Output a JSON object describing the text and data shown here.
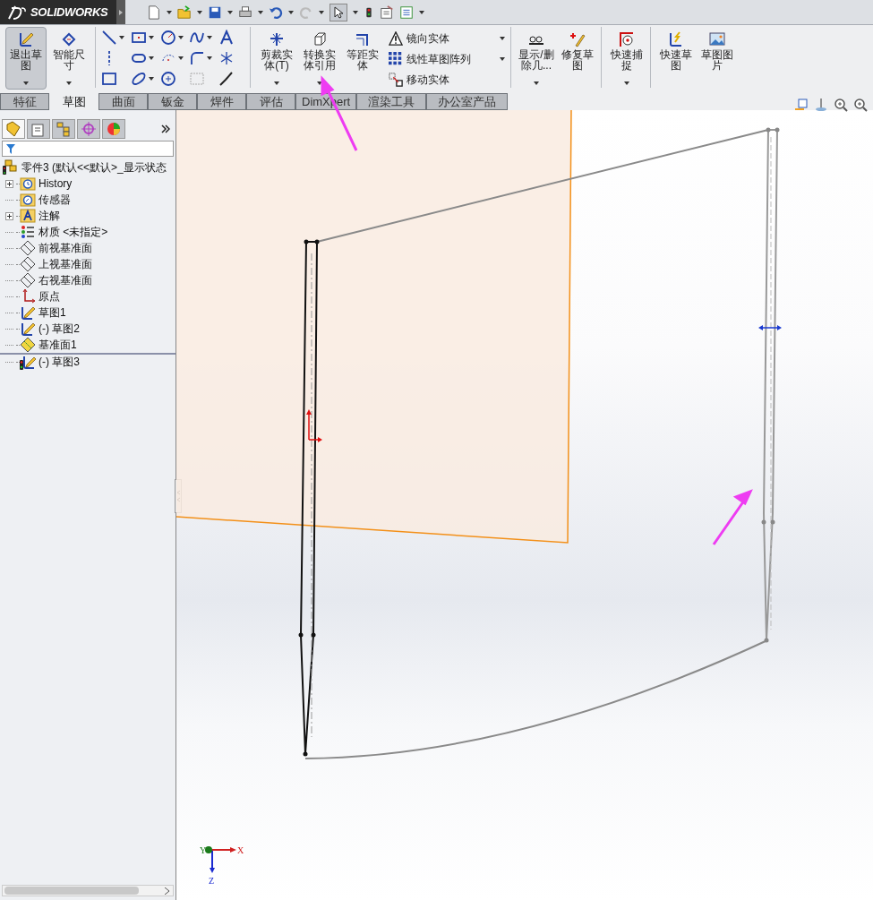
{
  "app": {
    "logo": "SOLIDWORKS"
  },
  "ribbon": {
    "large_buttons": [
      {
        "label": "退出草图",
        "selected": true
      },
      {
        "label": "智能尺寸",
        "selected": false
      }
    ],
    "edit_buttons": [
      "剪裁实体(T)",
      "转换实体引用",
      "等距实体"
    ],
    "small_buttons": [
      "镜向实体",
      "线性草图阵列",
      "移动实体"
    ],
    "extra_buttons": [
      "显示/删除几...",
      "修复草图",
      "快速捕捉",
      "快速草图",
      "草图图片"
    ]
  },
  "tabs": [
    {
      "label": "特征",
      "selected": false
    },
    {
      "label": "草图",
      "selected": true
    },
    {
      "label": "曲面",
      "selected": false
    },
    {
      "label": "钣金",
      "selected": false
    },
    {
      "label": "焊件",
      "selected": false
    },
    {
      "label": "评估",
      "selected": false
    },
    {
      "label": "DimXpert",
      "selected": false
    },
    {
      "label": "渲染工具",
      "selected": false
    },
    {
      "label": "办公室产品",
      "selected": false
    }
  ],
  "feature_tree": {
    "root": "零件3 (默认<<默认>_显示状态",
    "items": [
      {
        "label": "History",
        "kind": "history",
        "expandable": true,
        "below_rollback": false
      },
      {
        "label": "传感器",
        "kind": "sensor",
        "expandable": false,
        "below_rollback": false
      },
      {
        "label": "注解",
        "kind": "annotation",
        "expandable": true,
        "below_rollback": false
      },
      {
        "label": "材质 <未指定>",
        "kind": "material",
        "expandable": false,
        "below_rollback": false
      },
      {
        "label": "前视基准面",
        "kind": "plane",
        "expandable": false,
        "below_rollback": false
      },
      {
        "label": "上视基准面",
        "kind": "plane",
        "expandable": false,
        "below_rollback": false
      },
      {
        "label": "右视基准面",
        "kind": "plane",
        "expandable": false,
        "below_rollback": false
      },
      {
        "label": "原点",
        "kind": "origin",
        "expandable": false,
        "below_rollback": false
      },
      {
        "label": "草图1",
        "kind": "sketch",
        "expandable": false,
        "below_rollback": false
      },
      {
        "label": "(-) 草图2",
        "kind": "sketch",
        "expandable": false,
        "below_rollback": false
      },
      {
        "label": "基准面1",
        "kind": "refplane",
        "expandable": false,
        "below_rollback": false
      },
      {
        "label": "(-) 草图3",
        "kind": "sketch_error",
        "expandable": false,
        "below_rollback": true
      }
    ]
  },
  "triad": {
    "x_label": "X",
    "y_label": "Y",
    "z_label": "Z"
  }
}
